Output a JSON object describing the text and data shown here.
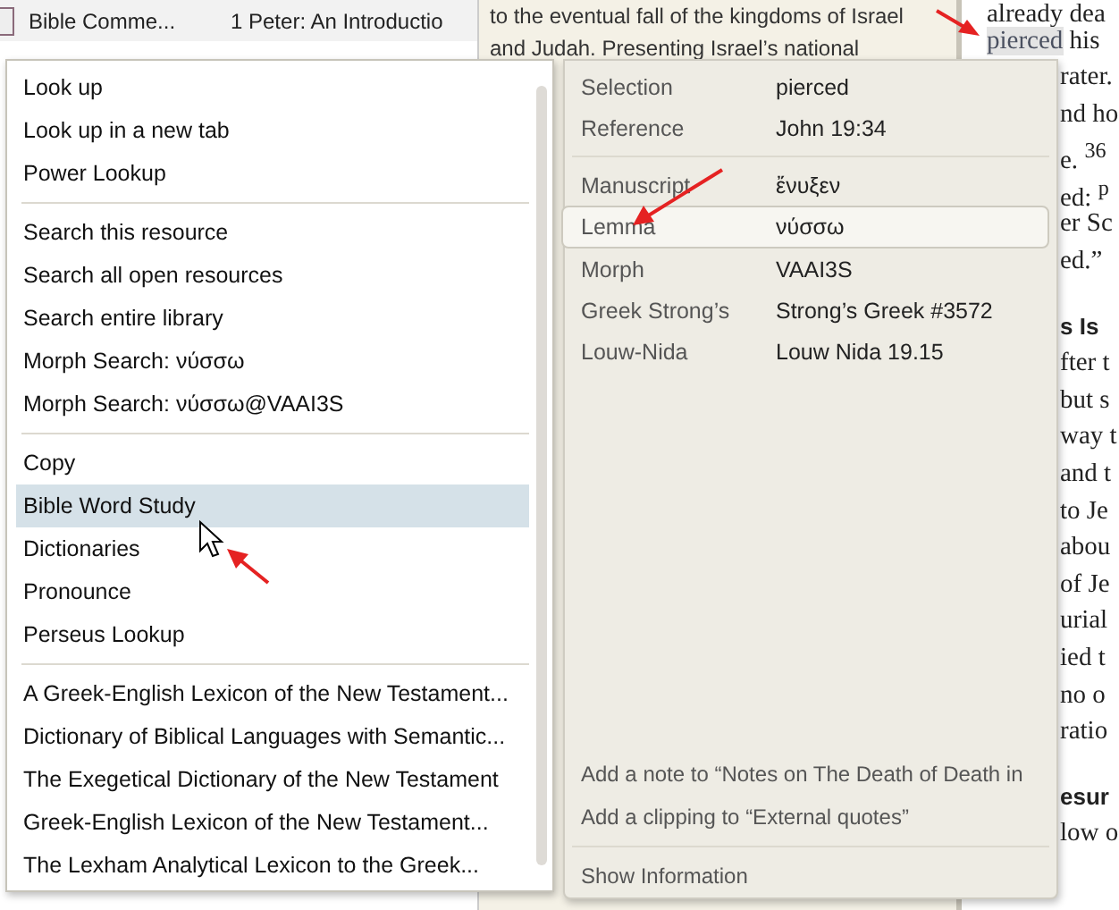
{
  "resource_list": {
    "rows": [
      {
        "type": "Bible Comme...",
        "title": "1 Peter: An Introductio",
        "selected": true
      }
    ]
  },
  "center_text": {
    "lines": [
      "to the eventual fall of the kingdoms of Israel",
      "and Judah. Presenting Israel’s national"
    ]
  },
  "book_text": {
    "lines": [
      {
        "kind": "full",
        "text": "already dea"
      },
      {
        "kind": "highlight",
        "text": "pierced",
        "rest": " his"
      },
      {
        "kind": "partial",
        "text": "rater."
      },
      {
        "kind": "partial",
        "text": "nd ho"
      },
      {
        "kind": "partial",
        "text": "e. $^{36}$"
      },
      {
        "kind": "partial",
        "text": "ed: $^{p}$"
      },
      {
        "kind": "partial",
        "text": "er Sc"
      },
      {
        "kind": "partial",
        "text": "ed.”"
      },
      {
        "kind": "heading",
        "text": "s Is"
      },
      {
        "kind": "partial",
        "text": "fter t"
      },
      {
        "kind": "partial",
        "text": "but s"
      },
      {
        "kind": "partial",
        "text": "way t"
      },
      {
        "kind": "partial",
        "text": "and t"
      },
      {
        "kind": "partial",
        "text": "to Je"
      },
      {
        "kind": "partial",
        "text": "abou"
      },
      {
        "kind": "partial",
        "text": "of Je"
      },
      {
        "kind": "partial",
        "text": "urial"
      },
      {
        "kind": "partial",
        "text": "ied t"
      },
      {
        "kind": "partial",
        "text": "no o"
      },
      {
        "kind": "partial",
        "text": "ratio"
      },
      {
        "kind": "heading",
        "text": "esur"
      },
      {
        "kind": "partial",
        "text": "low o"
      }
    ]
  },
  "context_menu": {
    "groups": [
      [
        {
          "label": "Look up",
          "selected": false
        },
        {
          "label": "Look up in a new tab",
          "selected": false
        },
        {
          "label": "Power Lookup",
          "selected": false
        }
      ],
      [
        {
          "label": "Search this resource",
          "selected": false
        },
        {
          "label": "Search all open resources",
          "selected": false
        },
        {
          "label": "Search entire library",
          "selected": false
        },
        {
          "label": "Morph Search: νύσσω",
          "selected": false
        },
        {
          "label": "Morph Search: νύσσω@VAAI3S",
          "selected": false
        }
      ],
      [
        {
          "label": "Copy",
          "selected": false
        },
        {
          "label": "Bible Word Study",
          "selected": true
        },
        {
          "label": "Dictionaries",
          "selected": false
        },
        {
          "label": "Pronounce",
          "selected": false
        },
        {
          "label": "Perseus Lookup",
          "selected": false
        }
      ],
      [
        {
          "label": "A Greek-English Lexicon of the New Testament...",
          "selected": false
        },
        {
          "label": "Dictionary of Biblical Languages with Semantic...",
          "selected": false
        },
        {
          "label": "The Exegetical Dictionary of the New Testament",
          "selected": false
        },
        {
          "label": "Greek-English Lexicon of the New Testament...",
          "selected": false
        },
        {
          "label": "The Lexham Analytical Lexicon to the Greek...",
          "selected": false
        }
      ]
    ]
  },
  "info_panel": {
    "groups": [
      [
        {
          "label": "Selection",
          "value": "pierced",
          "selected": false
        },
        {
          "label": "Reference",
          "value": "John 19:34",
          "selected": false
        }
      ],
      [
        {
          "label": "Manuscript",
          "value": "ἔνυξεν",
          "selected": false
        },
        {
          "label": "Lemma",
          "value": "νύσσω",
          "selected": true
        },
        {
          "label": "Morph",
          "value": "VAAI3S",
          "selected": false
        },
        {
          "label": "Greek Strong’s",
          "value": "Strong’s Greek #3572",
          "selected": false
        },
        {
          "label": "Louw-Nida",
          "value": "Louw Nida 19.15",
          "selected": false
        }
      ]
    ],
    "actions": [
      "Add a note to “Notes on The Death of Death in",
      "Add a clipping to “External quotes”"
    ],
    "footer": "Show Information"
  }
}
